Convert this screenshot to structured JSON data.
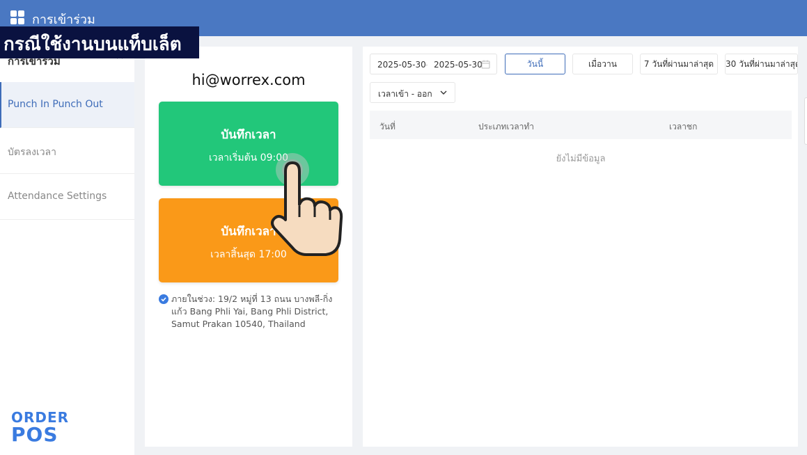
{
  "app": {
    "title": "การเข้าร่วม"
  },
  "banner": {
    "text": "กรณีใช้งานบนแท็บเล็ต"
  },
  "sidebar": {
    "header": "การเข้าร่วม",
    "items": [
      {
        "label": "Punch In Punch Out",
        "active": true
      },
      {
        "label": "บัตรลงเวลา",
        "active": false
      },
      {
        "label": "Attendance Settings",
        "active": false
      }
    ]
  },
  "logo": {
    "line1": "ORDER",
    "line2": "POS"
  },
  "punch": {
    "email": "hi@worrex.com",
    "in": {
      "title": "บันทึกเวลา",
      "subtitle": "เวลาเริ่มต้น 09:00"
    },
    "out": {
      "title": "บันทึกเวลา",
      "subtitle": "เวลาสิ้นสุด 17:00"
    },
    "location": "ภายในช่วง: 19/2 หมู่ที่ 13 ถนน บางพลี-กิ่งแก้ว Bang Phli Yai, Bang Phli District, Samut Prakan 10540, Thailand"
  },
  "records": {
    "date_start": "2025-05-30",
    "date_separator": "-",
    "date_end": "2025-05-30",
    "quick_ranges": [
      {
        "label": "วันนี้",
        "active": true
      },
      {
        "label": "เมื่อวาน",
        "active": false
      },
      {
        "label": "7 วันที่ผ่านมาล่าสุด",
        "active": false
      },
      {
        "label": "30 วันที่ผ่านมาล่าสุด",
        "active": false
      }
    ],
    "filter_value": "เวลาเข้า - ออก",
    "columns": [
      "วันที่",
      "ประเภทเวลาทำ",
      "เวลาชก"
    ],
    "empty_text": "ยังไม่มีข้อมูล"
  },
  "colors": {
    "topbar": "#4a78c2",
    "accent": "#3e6cb8",
    "punch_in": "#22c77a",
    "punch_out": "#fa9918",
    "banner": "#0a1240"
  }
}
